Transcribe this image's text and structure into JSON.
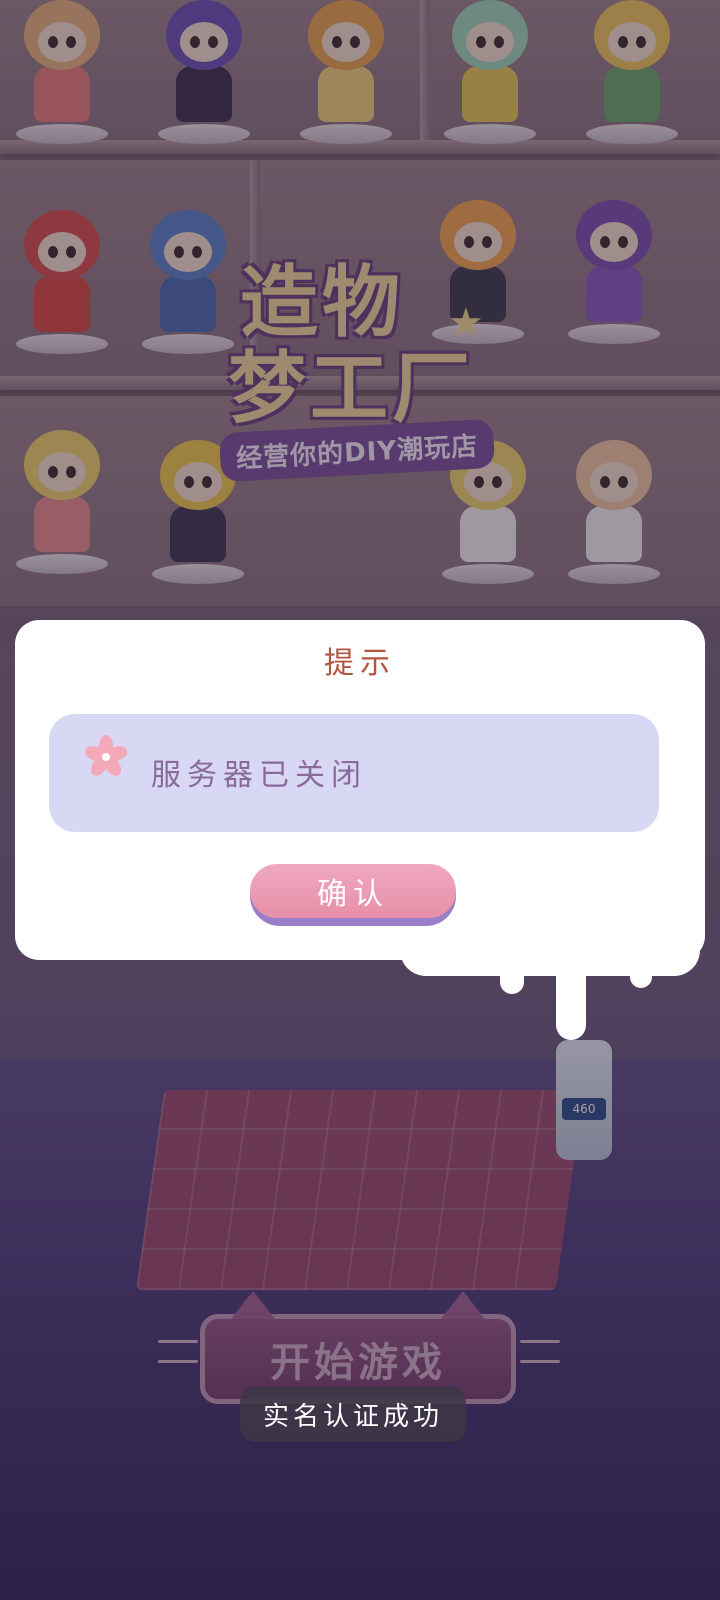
{
  "game": {
    "logo_line1": "造物",
    "logo_line2": "梦工厂",
    "logo_tagline": "经营你的DIY潮玩店",
    "start_button_label": "开始游戏"
  },
  "dialog": {
    "title": "提示",
    "message": "服务器已关闭",
    "confirm_label": "确认",
    "icon": "flower-icon"
  },
  "toast": {
    "text": "实名认证成功"
  },
  "props": {
    "glue_label": "460"
  },
  "colors": {
    "dialog_title": "#b0563f",
    "message_box_bg": "#d8d8f5",
    "message_text": "#8a6a9a",
    "confirm_button": "#e68ea8",
    "confirm_button_shadow": "#9a7fc8",
    "toast_bg": "#3c3746"
  }
}
